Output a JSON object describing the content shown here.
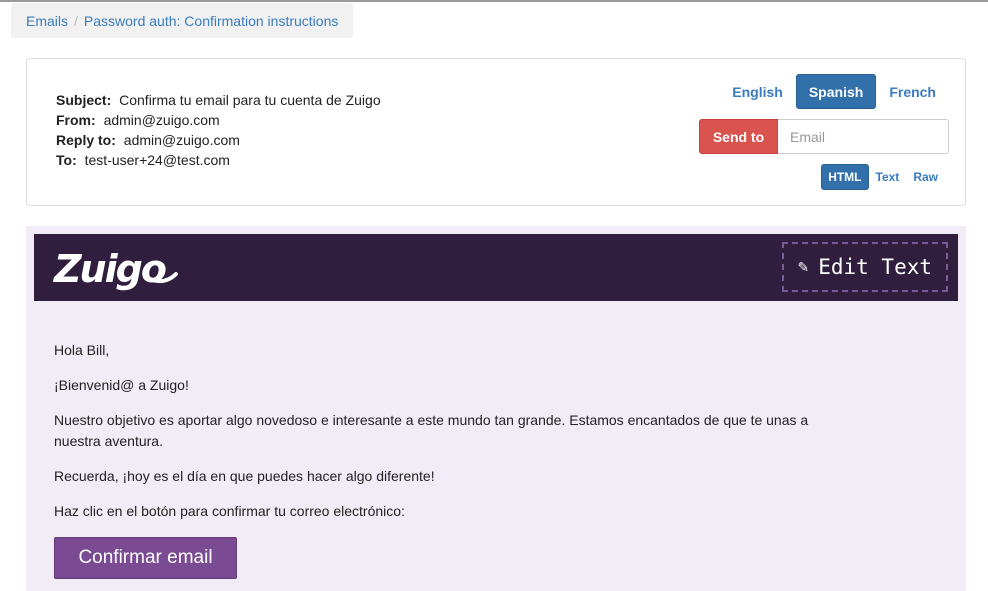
{
  "breadcrumb": {
    "items": [
      "Emails",
      "Password auth: Confirmation instructions"
    ],
    "separator": "/"
  },
  "meta": {
    "subject_label": "Subject:",
    "subject": "Confirma tu email para tu cuenta de Zuigo",
    "from_label": "From:",
    "from": "admin@zuigo.com",
    "reply_to_label": "Reply to:",
    "reply_to": "admin@zuigo.com",
    "to_label": "To:",
    "to": "test-user+24@test.com"
  },
  "languages": {
    "items": [
      "English",
      "Spanish",
      "French"
    ],
    "active": "Spanish"
  },
  "send": {
    "button_label": "Send to",
    "email_placeholder": "Email"
  },
  "formats": {
    "items": [
      "HTML",
      "Text",
      "Raw"
    ],
    "active": "HTML"
  },
  "email": {
    "logo_text": "Zuigo",
    "edit_text_label": "Edit Text",
    "edit_icon": "pencil-icon",
    "greeting": "Hola Bill,",
    "welcome": "¡Bienvenid@ a Zuigo!",
    "paragraph": "Nuestro objetivo es aportar algo novedoso e interesante a este mundo tan grande. Estamos encantados de que te unas a nuestra aventura.",
    "reminder": "Recuerda, ¡hoy es el día en que puedes hacer algo diferente!",
    "instruction": "Haz clic en el botón para confirmar tu correo electrónico:",
    "button_label": "Confirmar email"
  },
  "colors": {
    "banner": "#2f1e3d",
    "preview_bg": "#f1ecf5",
    "cta": "#7a4b93",
    "send_button": "#d9534f",
    "active_tab": "#3170aa",
    "link": "#3a7cc0"
  }
}
